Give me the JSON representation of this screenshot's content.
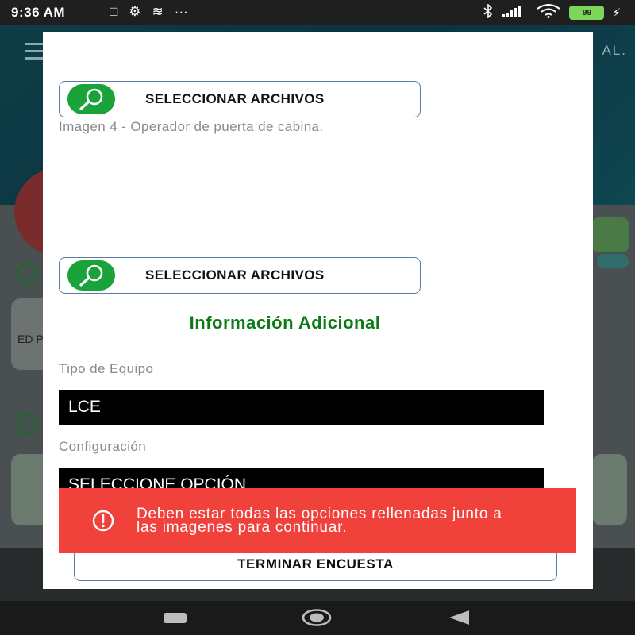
{
  "status_bar": {
    "time": "9:36 AM",
    "left_icons": [
      "□",
      "⚙",
      "≋",
      "···"
    ],
    "battery": "99"
  },
  "background": {
    "logo_text": "AL.",
    "card_label": "ED\nP"
  },
  "modal": {
    "file_button_1": {
      "label": "SELECCIONAR ARCHIVOS",
      "icon": "search-icon"
    },
    "caption": "Imagen 4 - Operador de puerta de cabina.",
    "file_button_2": {
      "label": "SELECCIONAR ARCHIVOS",
      "icon": "search-icon"
    },
    "section_title": "Información Adicional",
    "tipo_label": "Tipo de Equipo",
    "tipo_value": "LCE",
    "config_label": "Configuración",
    "config_value": "SELECCIONE OPCIÓN",
    "finish_button": "TERMINAR ENCUESTA"
  },
  "toast": {
    "message": "Deben estar todas las opciones rellenadas junto a las imagenes para continuar.",
    "icon": "error-circle-icon",
    "color": "#f0413b"
  },
  "colors": {
    "accent_green": "#19a33a",
    "title_green": "#0c7a16",
    "border_blue": "#5a7aa8"
  }
}
